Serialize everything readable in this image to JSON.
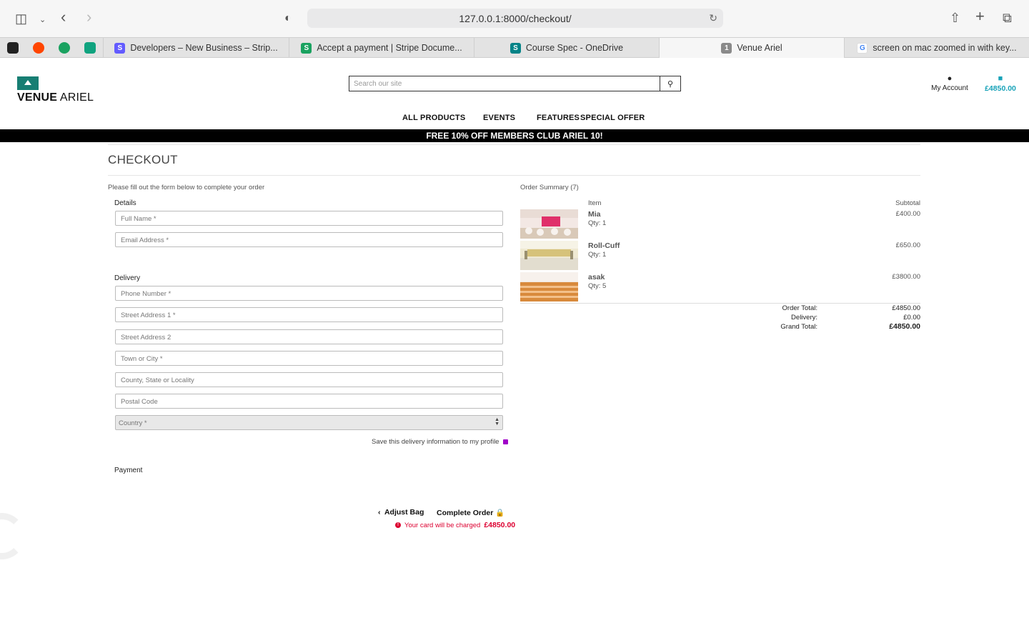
{
  "browser": {
    "url": "127.0.0.1:8000/checkout/",
    "tabs": [
      {
        "title": "Developers – New Business – Strip...",
        "favicon": "S",
        "color": "#635bff"
      },
      {
        "title": "Accept a payment | Stripe Docume...",
        "favicon": "S",
        "color": "#1aa260"
      },
      {
        "title": "Course Spec - OneDrive",
        "favicon": "S",
        "color": "#038387"
      },
      {
        "title": "Venue Ariel",
        "favicon": "1",
        "color": "#8a8a8a"
      },
      {
        "title": "screen on mac zoomed in with key...",
        "favicon": "G",
        "color": "#4285f4"
      }
    ]
  },
  "site": {
    "logo_bold": "VENUE",
    "logo_rest": " ARIEL",
    "search_placeholder": "Search our site",
    "account_label": "My Account",
    "cart_total": "£4850.00",
    "nav": [
      "ALL PRODUCTS",
      "EVENTS",
      "FEATURES",
      "SPECIAL OFFER"
    ],
    "banner": "FREE 10% OFF MEMBERS CLUB ARIEL 10!"
  },
  "checkout": {
    "title": "CHECKOUT",
    "intro": "Please fill out the form below to complete your order",
    "details_legend": "Details",
    "full_name": "Full Name *",
    "email": "Email Address *",
    "delivery_legend": "Delivery",
    "phone": "Phone Number *",
    "street1": "Street Address 1 *",
    "street2": "Street Address 2",
    "town": "Town or City *",
    "county": "County, State or Locality",
    "postcode": "Postal Code",
    "country": "Country *",
    "save_info": "Save this delivery information to my profile",
    "payment_legend": "Payment",
    "adjust_bag": "Adjust Bag",
    "complete_order": "Complete Order",
    "charge_text": "Your card will be charged",
    "charge_amount": "£4850.00"
  },
  "summary": {
    "title": "Order Summary (7)",
    "col_item": "Item",
    "col_subtotal": "Subtotal",
    "items": [
      {
        "name": "Mia",
        "qty": "Qty: 1",
        "subtotal": "£400.00"
      },
      {
        "name": "Roll-Cuff",
        "qty": "Qty: 1",
        "subtotal": "£650.00"
      },
      {
        "name": "asak",
        "qty": "Qty: 5",
        "subtotal": "£3800.00"
      }
    ],
    "order_total_label": "Order Total:",
    "order_total": "£4850.00",
    "delivery_label": "Delivery:",
    "delivery": "£0.00",
    "grand_total_label": "Grand Total:",
    "grand_total": "£4850.00"
  },
  "colors": {
    "brand": "#177e73",
    "cart": "#17a2b8",
    "error": "#dc0030"
  }
}
